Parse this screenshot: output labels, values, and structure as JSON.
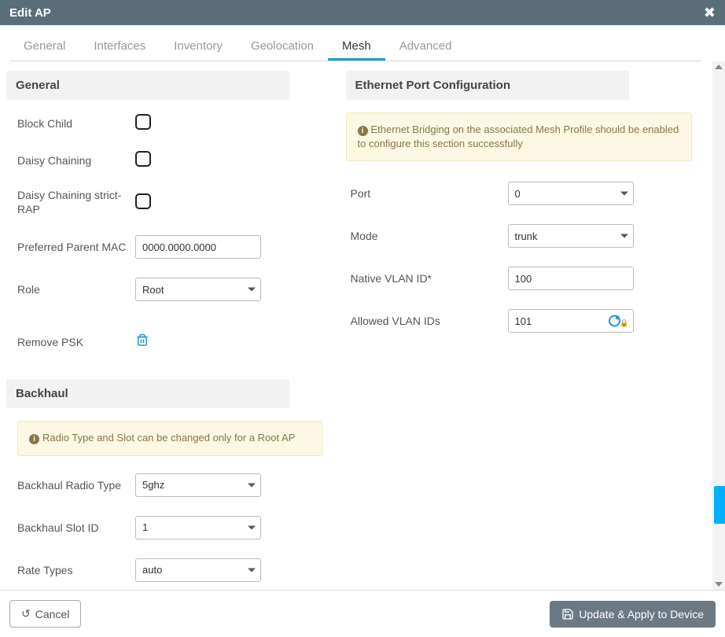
{
  "header": {
    "title": "Edit AP"
  },
  "tabs": {
    "items": [
      "General",
      "Interfaces",
      "Inventory",
      "Geolocation",
      "Mesh",
      "Advanced"
    ],
    "activeIndex": 4
  },
  "sections": {
    "general": "General",
    "backhaul": "Backhaul",
    "eth": "Ethernet Port Configuration"
  },
  "labels": {
    "blockChild": "Block Child",
    "daisy": "Daisy Chaining",
    "daisyStrict": "Daisy Chaining strict-RAP",
    "preferredParent": "Preferred Parent MAC",
    "role": "Role",
    "removePsk": "Remove PSK",
    "backhaulRadio": "Backhaul Radio Type",
    "backhaulSlot": "Backhaul Slot ID",
    "rateTypes": "Rate Types",
    "port": "Port",
    "mode": "Mode",
    "nativeVlan": "Native VLAN ID*",
    "allowedVlan": "Allowed VLAN IDs"
  },
  "values": {
    "preferredParent": "0000.0000.0000",
    "role": "Root",
    "backhaulRadio": "5ghz",
    "backhaulSlot": "1",
    "rateTypes": "auto",
    "port": "0",
    "mode": "trunk",
    "nativeVlan": "100",
    "allowedVlan": "101"
  },
  "info": {
    "backhaul": "Radio Type and Slot can be changed only for a Root AP",
    "eth": "Ethernet Bridging on the associated Mesh Profile should be enabled to configure this section successfully"
  },
  "footer": {
    "cancel": "Cancel",
    "apply": "Update & Apply to Device"
  }
}
